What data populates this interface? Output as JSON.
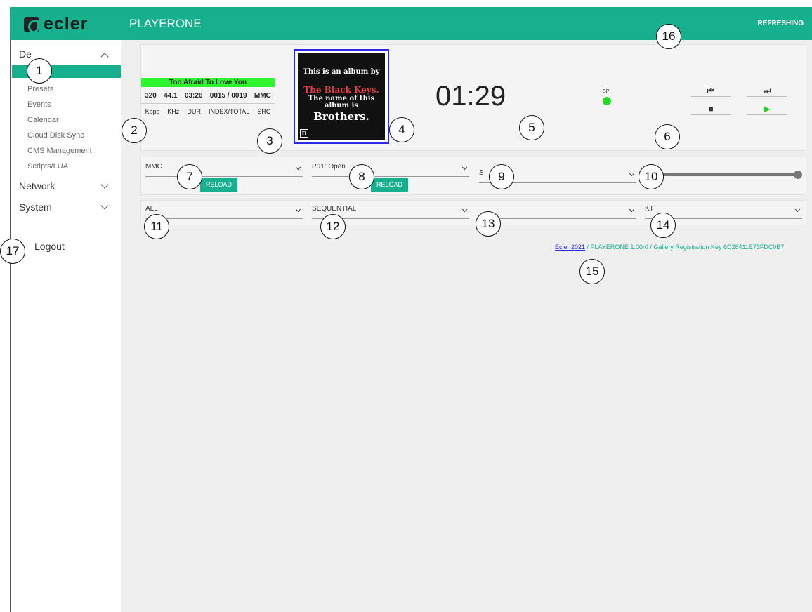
{
  "header": {
    "logo": "ecler",
    "app_title": "PLAYERONE",
    "status": "REFRESHING"
  },
  "sidebar": {
    "device_label": "De",
    "sub_items": [
      "Presets",
      "Events",
      "Calendar",
      "Cloud Disk Sync",
      "CMS Management",
      "Scripts/LUA"
    ],
    "network": "Network",
    "system": "System",
    "logout": "Logout"
  },
  "player": {
    "track_title": "Too Afraid To Love You",
    "info_values": [
      "320",
      "44.1",
      "03:26",
      "0015 / 0019",
      "MMC"
    ],
    "info_labels": [
      "Kbps",
      "KHz",
      "DUR",
      "INDEX/TOTAL",
      "SRC"
    ],
    "album_line1": "This is an album by",
    "album_artist": "The Black Keys.",
    "album_line3": "The name of this album is",
    "album_title": "Brothers.",
    "album_badge": "D",
    "elapsed": "01:29",
    "sp_label": "SP",
    "sp_color": "#22dd22"
  },
  "transport": {
    "prev": "⏮",
    "next": "⏭",
    "stop": "■",
    "play": "▶"
  },
  "controls": {
    "source_select": "MMC",
    "reload1": "RELOAD",
    "preset_select": "P01: Open",
    "reload2": "RELOAD",
    "third_select": "S",
    "volume_level": 1.0,
    "mode_select": "ALL",
    "playback_select": "SEQUENTIAL",
    "other_select": "",
    "kt_select": "KT"
  },
  "footer": {
    "link": "Ecler 2021",
    "info": " / PLAYERONE 1.00r0 / Gallery Registration Key 6D28411E73FDC0B7"
  },
  "callouts": [
    "1",
    "2",
    "3",
    "4",
    "5",
    "6",
    "7",
    "8",
    "9",
    "10",
    "11",
    "12",
    "13",
    "14",
    "15",
    "16",
    "17"
  ],
  "colors": {
    "accent": "#16b08f",
    "now_playing": "#2ff52f"
  }
}
